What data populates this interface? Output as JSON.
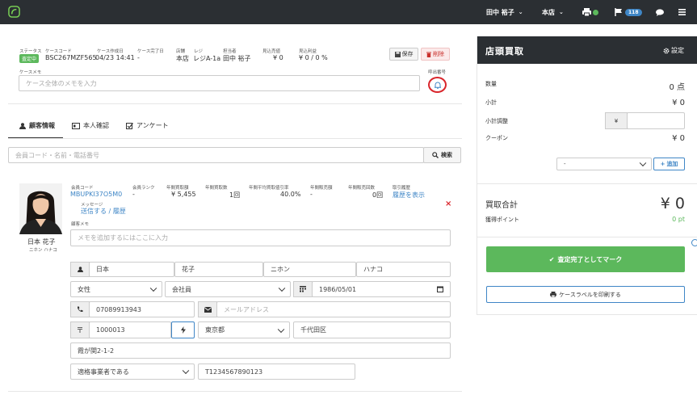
{
  "topbar": {
    "user": "田中 裕子",
    "store": "本店",
    "badge": "118"
  },
  "case": {
    "status_label": "ステータス",
    "status": "査定中",
    "code_label": "ケースコード",
    "code": "BSC267MZF565",
    "created_label": "ケース作成日",
    "created": "04/23 14:41",
    "completed_label": "ケース完了日",
    "completed": "-",
    "store_label": "店舗",
    "store": "本店",
    "register_label": "レジ",
    "register": "レジA-1a",
    "staff_label": "担当者",
    "staff": "田中 裕子",
    "estimate_label": "見込売値",
    "estimate": "¥ 0",
    "profit_label": "見込利益",
    "profit": "¥ 0 / 0 %",
    "save": "保存",
    "delete": "削除",
    "memo_label": "ケースメモ",
    "memo_placeholder": "ケース全体のメモを入力",
    "call_number_label": "呼出番号"
  },
  "tabs": {
    "customer": "顧客情報",
    "identity": "本人確認",
    "survey": "アンケート"
  },
  "search": {
    "placeholder": "会員コード・名前・電話番号",
    "button": "検索"
  },
  "customer": {
    "name": "日本 花子",
    "kana": "ニホン ハナコ",
    "code_label": "会員コード",
    "code": "MBUPKI37O5M0",
    "rank_label": "会員ランク",
    "rank": "-",
    "buy_amount_label": "年間買取額",
    "buy_amount": "¥ 5,455",
    "buy_count_label": "年間買取数",
    "buy_count": "1回",
    "discount_label": "年間平均買取値引率",
    "discount": "40.0%",
    "sale_amount_label": "年間販売額",
    "sale_amount": "-",
    "sale_count_label": "年間販売回数",
    "sale_count": "0回",
    "history_label": "取引履歴",
    "history_link": "履歴を表示",
    "message_label": "メッセージ",
    "message_send": "送信する",
    "message_sep": "/",
    "message_history": "履歴",
    "memo_label": "顧客メモ",
    "memo_placeholder": "メモを追加するにはここに入力",
    "last_name": "日本",
    "first_name": "花子",
    "last_kana": "ニホン",
    "first_kana": "ハナコ",
    "gender": "女性",
    "occupation": "会社員",
    "birthday": "1986/05/01",
    "phone": "07089913943",
    "email_placeholder": "メールアドレス",
    "zip": "1000013",
    "prefecture": "東京都",
    "city": "千代田区",
    "address": "霞が関2-1-2",
    "tax_status": "適格事業者である",
    "tax_number": "T1234567890123"
  },
  "panel": {
    "title": "店頭買取",
    "settings": "設定",
    "qty_label": "数量",
    "qty": "0 点",
    "subtotal_label": "小計",
    "subtotal": "¥ 0",
    "adjust_label": "小計調整",
    "adjust_prefix": "¥",
    "coupon_label": "クーポン",
    "coupon": "¥ 0",
    "coupon_select": "-",
    "add": "追加",
    "total_label": "買取合計",
    "total": "¥ 0",
    "points_label": "獲得ポイント",
    "points": "0 pt",
    "complete": "査定完了としてマーク",
    "print": "ケースラベルを印刷する"
  }
}
